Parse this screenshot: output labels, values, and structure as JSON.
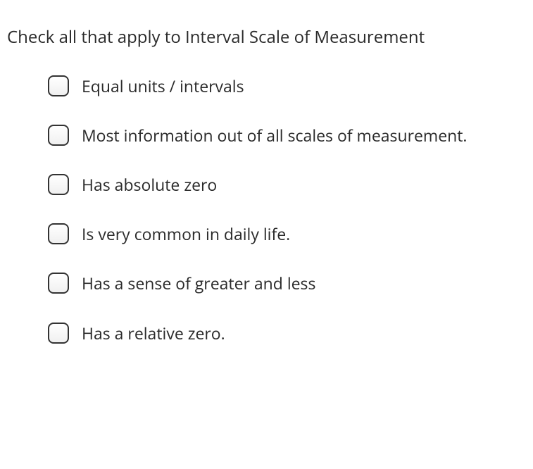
{
  "question": {
    "prompt": "Check all that apply to Interval Scale of Measurement",
    "options": [
      {
        "label": "Equal units / intervals",
        "checked": false
      },
      {
        "label": "Most information out of all scales of measurement.",
        "checked": false
      },
      {
        "label": "Has absolute zero",
        "checked": false
      },
      {
        "label": "Is very common in daily life.",
        "checked": false
      },
      {
        "label": "Has a sense of greater and less",
        "checked": false
      },
      {
        "label": "Has a relative zero.",
        "checked": false
      }
    ]
  }
}
